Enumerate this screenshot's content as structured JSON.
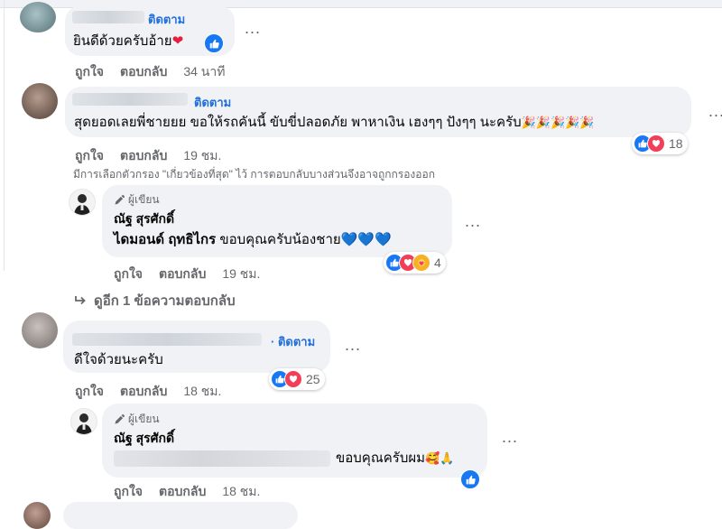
{
  "labels": {
    "follow": "ติดตาม",
    "like": "ถูกใจ",
    "reply": "ตอบกลับ",
    "author_badge": "ผู้เขียน",
    "more": "..."
  },
  "comments": [
    {
      "text": "ยินดีด้วยครับอ้าย",
      "emoji": "❤",
      "time": "34 นาที"
    },
    {
      "text": "สุดยอดเลยพี่ชายยย ขอให้รถคันนี้ ขับขี่ปลอดภัย พาหาเงิน เฮงๆๆ ปังๆๆ นะครับ",
      "emoji": "🎉🎉🎉🎉🎉",
      "time": "19 ชม.",
      "reaction_count": "18"
    },
    {
      "text": "ดีใจด้วยนะครับ",
      "time": "18 ชม.",
      "reaction_count": "25"
    }
  ],
  "filter_notice": "มีการเลือกตัวกรอง \"เกี่ยวข้องที่สุด\" ไว้ การตอบกลับบางส่วนจึงอาจถูกกรองออก",
  "replies": [
    {
      "author": "ณัฐ สุรศักดิ์",
      "mention": "ไดมอนด์ ฤทธิไกร",
      "text": " ขอบคุณครับน้องชาย",
      "emoji": "💙💙💙",
      "time": "19 ชม.",
      "reaction_count": "4"
    },
    {
      "author": "ณัฐ สุรศักดิ์",
      "text": "ขอบคุณครับผม",
      "emoji": "🥰🙏",
      "time": "18 ชม."
    }
  ],
  "view_more_replies": "ดูอีก 1 ข้อความตอบกลับ",
  "colors": {
    "follow_blue": "#216fdb",
    "like_blue": "#1877f2",
    "love_red": "#f33e58",
    "care_yellow": "#f7b125",
    "bubble_gray": "#f0f2f5",
    "meta_gray": "#65676b"
  },
  "icons": [
    "like-icon",
    "love-icon",
    "care-icon",
    "pen-icon",
    "reply-arrow-icon",
    "more-dots-icon"
  ]
}
